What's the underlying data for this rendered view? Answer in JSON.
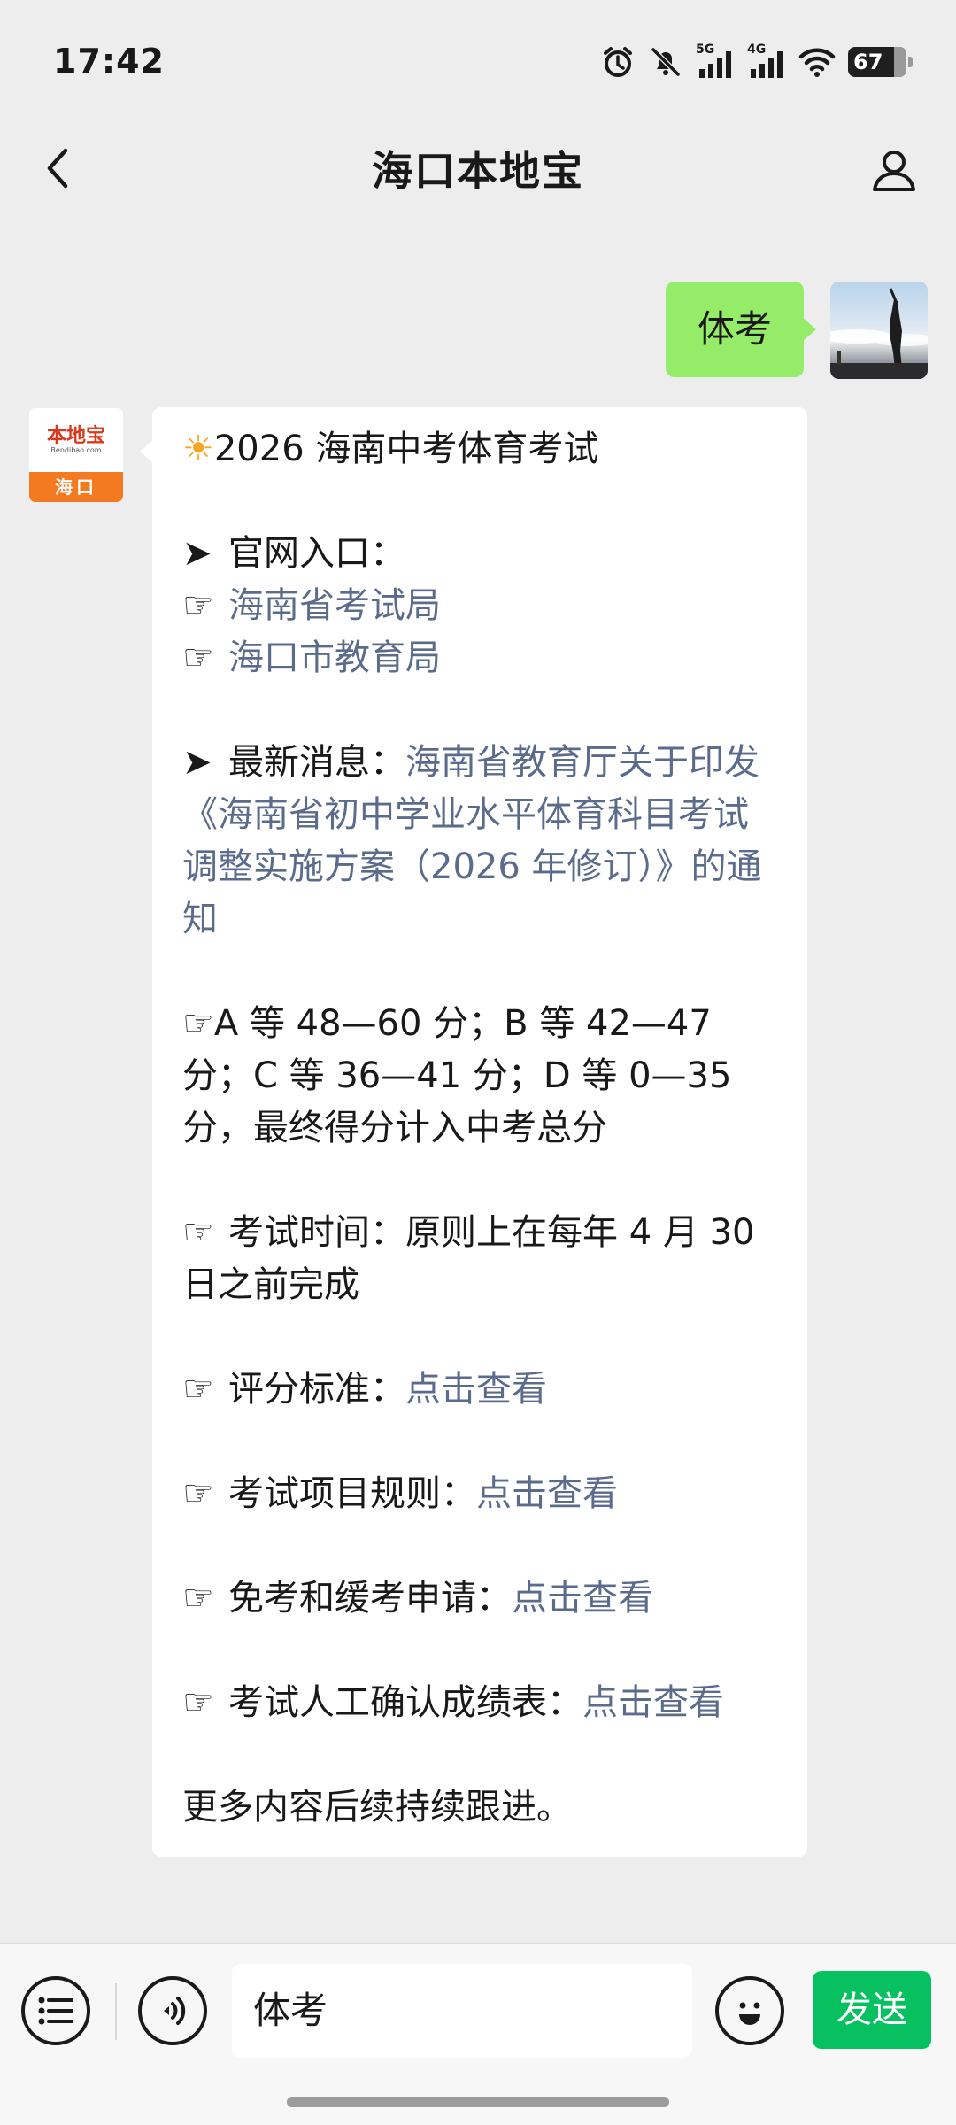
{
  "status_bar": {
    "time": "17:42",
    "network_1": "5G",
    "network_2": "4G",
    "battery": "67"
  },
  "header": {
    "title": "海口本地宝",
    "back_icon": "chevron-left-icon",
    "profile_icon": "person-icon"
  },
  "outgoing_message": {
    "text": "体考"
  },
  "bot_avatar": {
    "brand": "本地宝",
    "url": "Bendibao.com",
    "city": "海口"
  },
  "reply": {
    "title": "2026 海南中考体育考试",
    "official_heading": "官网入口：",
    "official_links": [
      "海南省考试局",
      "海口市教育局"
    ],
    "news_label": "最新消息：",
    "news_link": "海南省教育厅关于印发《海南省初中学业水平体育科目考试调整实施方案（2026 年修订）》的通知",
    "grades": "A 等 48—60 分；B 等 42—47 分；C 等 36—41 分；D 等 0—35 分，最终得分计入中考总分",
    "exam_time": "考试时间：原则上在每年 4 月 30日之前完成",
    "items": [
      {
        "label": "评分标准：",
        "link": "点击查看"
      },
      {
        "label": "考试项目规则：",
        "link": "点击查看"
      },
      {
        "label": "免考和缓考申请：",
        "link": "点击查看"
      },
      {
        "label": "考试人工确认成绩表：",
        "link": "点击查看"
      }
    ],
    "footer": "更多内容后续持续跟进。"
  },
  "composer": {
    "input_value": "体考",
    "send_label": "发送"
  },
  "colors": {
    "out_bubble": "#95ec69",
    "link": "#5b6b8c",
    "send_button": "#07c160"
  }
}
